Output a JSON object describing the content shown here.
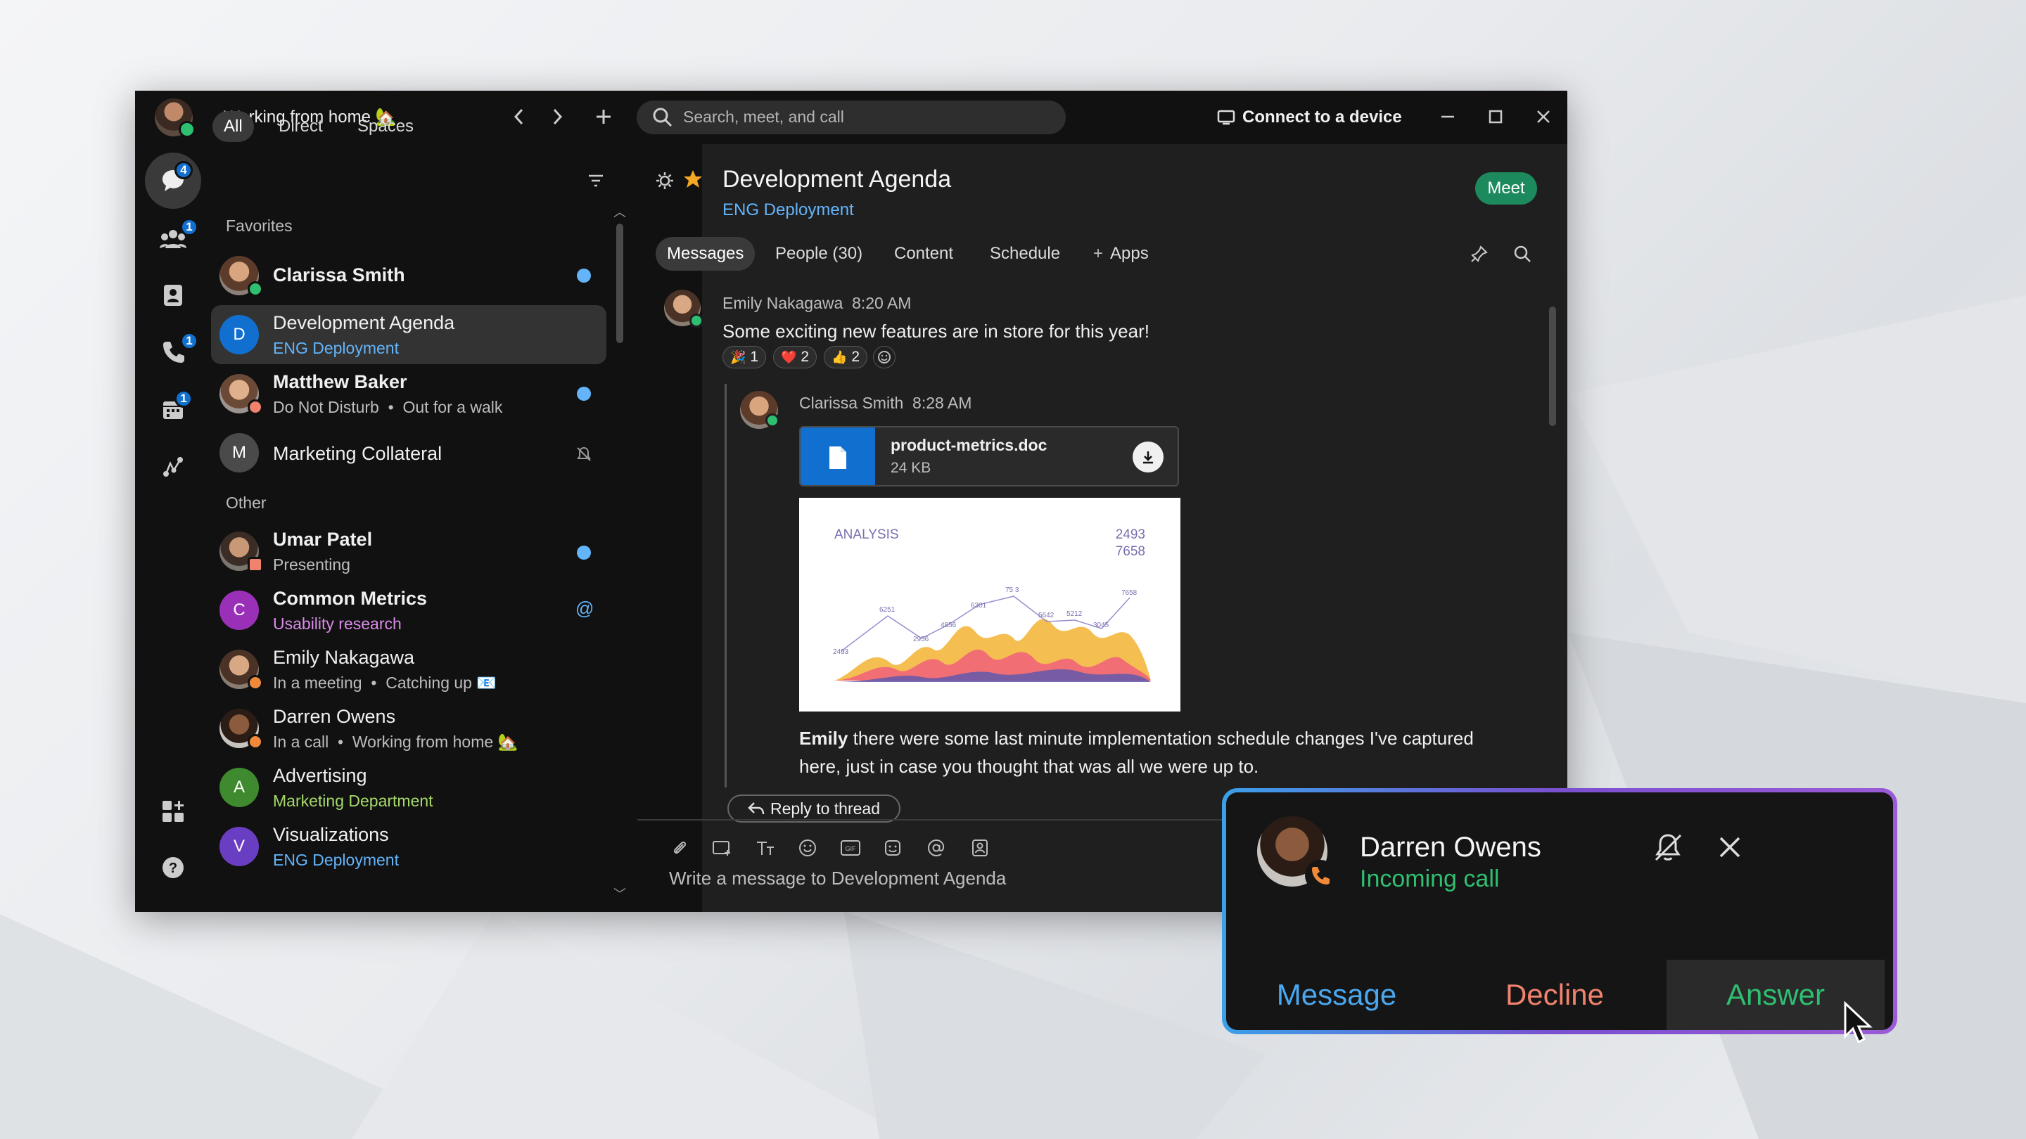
{
  "titlebar": {
    "status": "Working from home 🏡",
    "search_placeholder": "Search, meet, and call",
    "connect_device": "Connect to a device"
  },
  "rail": {
    "badges": {
      "messaging": "4",
      "teams": "1",
      "calling": "1",
      "meetings": "1"
    }
  },
  "filters": [
    "All",
    "Direct",
    "Spaces"
  ],
  "sections": {
    "favorites": "Favorites",
    "other": "Other"
  },
  "conversations": [
    {
      "name": "Clarissa Smith",
      "sub": ""
    },
    {
      "initial": "D",
      "name": "Development Agenda",
      "sub": "ENG Deployment"
    },
    {
      "name": "Matthew Baker",
      "sub": "Do Not Disturb",
      "sub2": "Out for a walk"
    },
    {
      "initial": "M",
      "name": "Marketing Collateral",
      "sub": ""
    },
    {
      "name": "Umar Patel",
      "sub": "Presenting"
    },
    {
      "initial": "C",
      "name": "Common Metrics",
      "sub": "Usability research",
      "mention": "@"
    },
    {
      "name": "Emily Nakagawa",
      "sub": "In a meeting",
      "sub2": "Catching up 📧"
    },
    {
      "name": "Darren Owens",
      "sub": "In a call",
      "sub2": "Working from home 🏡"
    },
    {
      "initial": "A",
      "name": "Advertising",
      "sub": "Marketing Department"
    },
    {
      "initial": "V",
      "name": "Visualizations",
      "sub": "ENG Deployment"
    }
  ],
  "space": {
    "title": "Development Agenda",
    "team": "ENG Deployment",
    "meet_button": "Meet",
    "tabs": [
      "Messages",
      "People (30)",
      "Content",
      "Schedule",
      "Apps"
    ]
  },
  "messages": [
    {
      "author": "Emily Nakagawa",
      "time": "8:20 AM",
      "text": "Some exciting new features are in store for this year!",
      "reactions": [
        {
          "emoji": "🎉",
          "count": "1"
        },
        {
          "emoji": "❤️",
          "count": "2"
        },
        {
          "emoji": "👍",
          "count": "2"
        }
      ]
    },
    {
      "author": "Clarissa Smith",
      "time": "8:28 AM",
      "file": {
        "name": "product-metrics.doc",
        "size": "24 KB"
      },
      "chart_preview": {
        "title": "ANALYSIS",
        "num1": "2493",
        "num2": "7658",
        "point_labels": [
          "2493",
          "6251",
          "2956",
          "4856",
          "6301",
          "75 3",
          "5642",
          "5212",
          "3045",
          "7658"
        ]
      },
      "mention": "Emily",
      "text": " there were some last minute implementation schedule changes I've captured here, just in case you thought that was all we were up to."
    }
  ],
  "reply_thread": "Reply to thread",
  "composer_placeholder": "Write a message to Development Agenda",
  "incoming_call": {
    "name": "Darren Owens",
    "status": "Incoming call",
    "message_btn": "Message",
    "decline_btn": "Decline",
    "answer_btn": "Answer"
  },
  "colors": {
    "accent_blue": "#64b4fa",
    "meet_green": "#1d8a5e",
    "answer_green": "#2fbf71",
    "decline_red": "#f0826e",
    "message_blue": "#4aa8f0"
  }
}
